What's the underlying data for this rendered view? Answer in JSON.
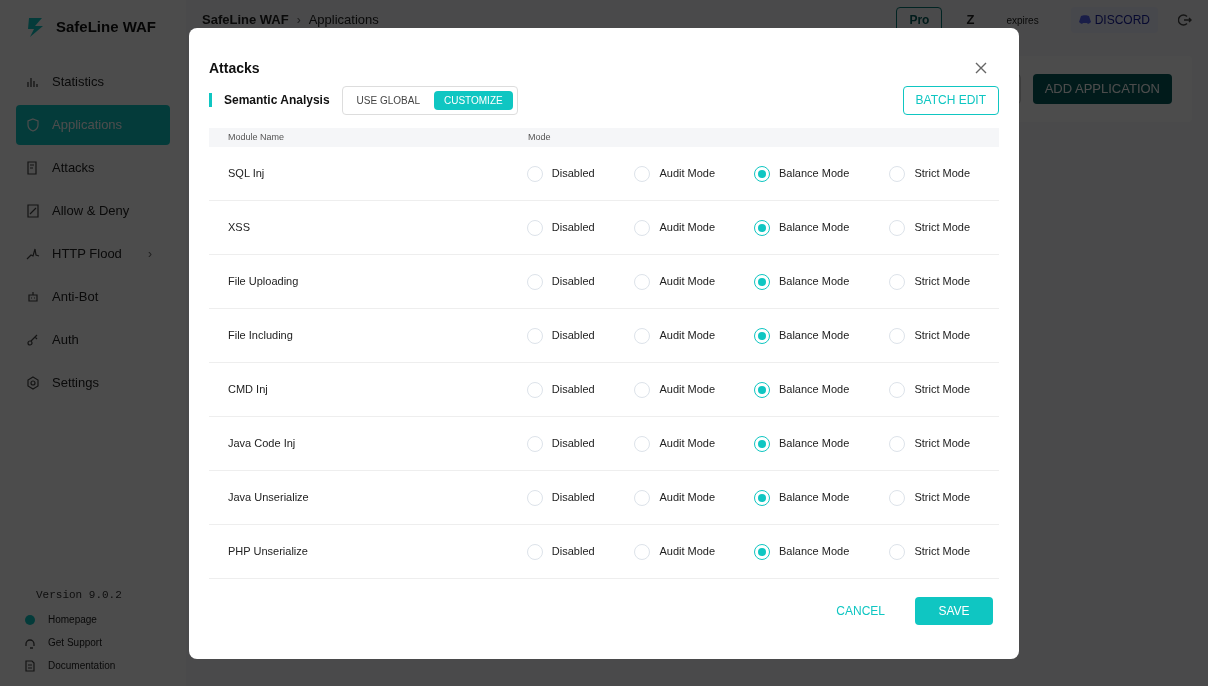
{
  "app": {
    "logo": "SafeLine WAF",
    "breadcrumb": [
      "SafeLine WAF",
      "Applications"
    ],
    "separator": "›",
    "badge": "Pro",
    "user": "Z",
    "expiry": "expires",
    "discord": "DISCORD"
  },
  "sidebar": {
    "items": [
      {
        "label": "Statistics",
        "selected": false,
        "kind": "item"
      },
      {
        "label": "Applications",
        "selected": true,
        "kind": "item"
      },
      {
        "label": "Attacks",
        "selected": false,
        "kind": "item"
      },
      {
        "label": "Allow & Deny",
        "selected": false,
        "kind": "item"
      },
      {
        "label": "HTTP Flood",
        "selected": false,
        "kind": "group",
        "chevron": "›"
      },
      {
        "label": "Anti-Bot",
        "selected": false,
        "kind": "item"
      },
      {
        "label": "Auth",
        "selected": false,
        "kind": "item"
      },
      {
        "label": "Settings",
        "selected": false,
        "kind": "item"
      }
    ],
    "version": "Version 9.0.2",
    "links": [
      "Homepage",
      "Get Support",
      "Documentation"
    ]
  },
  "main": {
    "add_button": "ADD APPLICATION"
  },
  "dialog": {
    "title": "Attacks",
    "section": "Semantic Analysis",
    "toggle": [
      {
        "label": "USE GLOBAL",
        "selected": false
      },
      {
        "label": "CUSTOMIZE",
        "selected": true
      }
    ],
    "batch_button": "BATCH EDIT",
    "columns": [
      "Module Name",
      "Mode"
    ],
    "rows": [
      {
        "name": "SQL Inj",
        "options": [
          {
            "label": "Disabled",
            "selected": false
          },
          {
            "label": "Audit Mode",
            "selected": false
          },
          {
            "label": "Balance Mode",
            "selected": true
          },
          {
            "label": "Strict Mode",
            "selected": false
          }
        ]
      },
      {
        "name": "XSS",
        "options": [
          {
            "label": "Disabled",
            "selected": false
          },
          {
            "label": "Audit Mode",
            "selected": false
          },
          {
            "label": "Balance Mode",
            "selected": true
          },
          {
            "label": "Strict Mode",
            "selected": false
          }
        ]
      },
      {
        "name": "File Uploading",
        "options": [
          {
            "label": "Disabled",
            "selected": false
          },
          {
            "label": "Audit Mode",
            "selected": false
          },
          {
            "label": "Balance Mode",
            "selected": true
          },
          {
            "label": "Strict Mode",
            "selected": false
          }
        ]
      },
      {
        "name": "File Including",
        "options": [
          {
            "label": "Disabled",
            "selected": false
          },
          {
            "label": "Audit Mode",
            "selected": false
          },
          {
            "label": "Balance Mode",
            "selected": true
          },
          {
            "label": "Strict Mode",
            "selected": false
          }
        ]
      },
      {
        "name": "CMD Inj",
        "options": [
          {
            "label": "Disabled",
            "selected": false
          },
          {
            "label": "Audit Mode",
            "selected": false
          },
          {
            "label": "Balance Mode",
            "selected": true
          },
          {
            "label": "Strict Mode",
            "selected": false
          }
        ]
      },
      {
        "name": "Java Code Inj",
        "options": [
          {
            "label": "Disabled",
            "selected": false
          },
          {
            "label": "Audit Mode",
            "selected": false
          },
          {
            "label": "Balance Mode",
            "selected": true
          },
          {
            "label": "Strict Mode",
            "selected": false
          }
        ]
      },
      {
        "name": "Java Unserialize",
        "options": [
          {
            "label": "Disabled",
            "selected": false
          },
          {
            "label": "Audit Mode",
            "selected": false
          },
          {
            "label": "Balance Mode",
            "selected": true
          },
          {
            "label": "Strict Mode",
            "selected": false
          }
        ]
      },
      {
        "name": "PHP Unserialize",
        "options": [
          {
            "label": "Disabled",
            "selected": false
          },
          {
            "label": "Audit Mode",
            "selected": false
          },
          {
            "label": "Balance Mode",
            "selected": true
          },
          {
            "label": "Strict Mode",
            "selected": false
          }
        ]
      }
    ],
    "cancel": "CANCEL",
    "save": "SAVE"
  }
}
